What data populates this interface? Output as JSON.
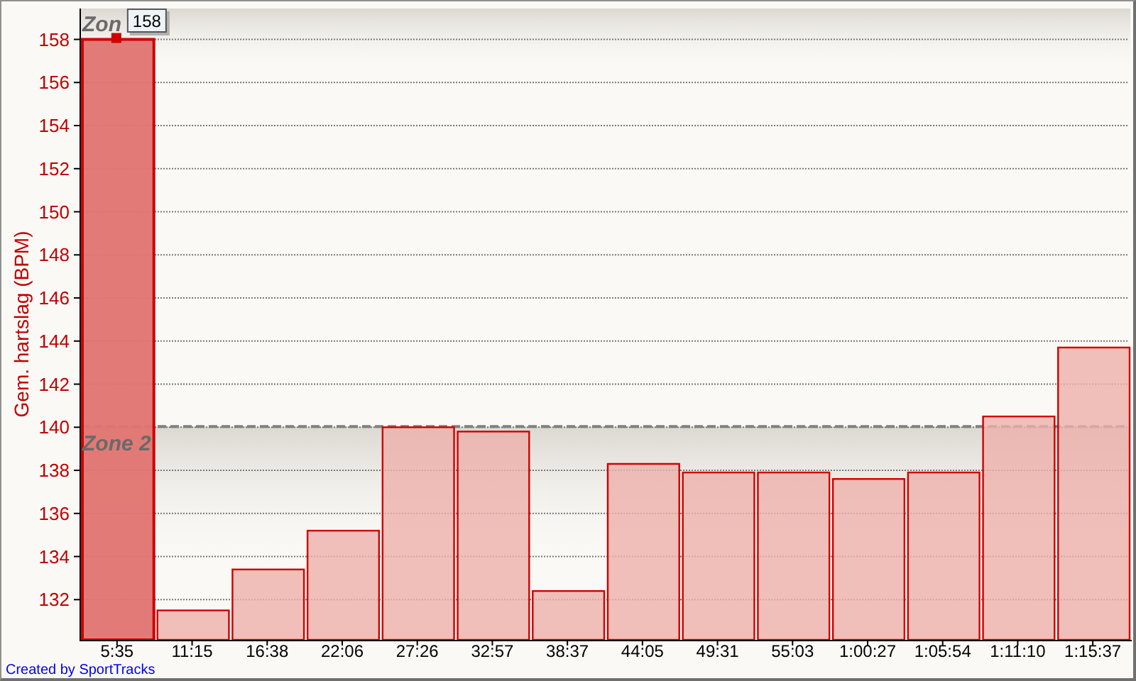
{
  "chart": {
    "chart_data": {
      "type": "bar",
      "ylabel": "Gem. hartslag (BPM)",
      "categories": [
        "5:35",
        "11:15",
        "16:38",
        "22:06",
        "27:26",
        "32:57",
        "38:37",
        "44:05",
        "49:31",
        "55:03",
        "1:00:27",
        "1:05:54",
        "1:11:10",
        "1:15:37"
      ],
      "series": [
        {
          "color": "#d00000",
          "values": [
            158,
            131.5,
            133.4,
            135.2,
            140.0,
            139.8,
            132.4,
            138.3,
            137.9,
            137.9,
            137.6,
            137.9,
            140.5,
            143.7
          ]
        }
      ],
      "ylim": [
        130.1,
        159.4
      ],
      "yticks": [
        132,
        134,
        136,
        138,
        140,
        142,
        144,
        146,
        148,
        150,
        152,
        154,
        156,
        158
      ],
      "grid": true,
      "bands": [
        {
          "axis": "y",
          "from": 140,
          "to": 159.4,
          "label": "Zon"
        },
        {
          "axis": "y",
          "from": 130.1,
          "to": 140,
          "label": "Zone 2"
        }
      ],
      "ref_lines": [
        {
          "axis": "y",
          "value": 140
        }
      ],
      "annotations": [
        {
          "text": "158",
          "x": "5:35",
          "y": 158
        }
      ]
    },
    "credit": "Created by SportTracks"
  }
}
